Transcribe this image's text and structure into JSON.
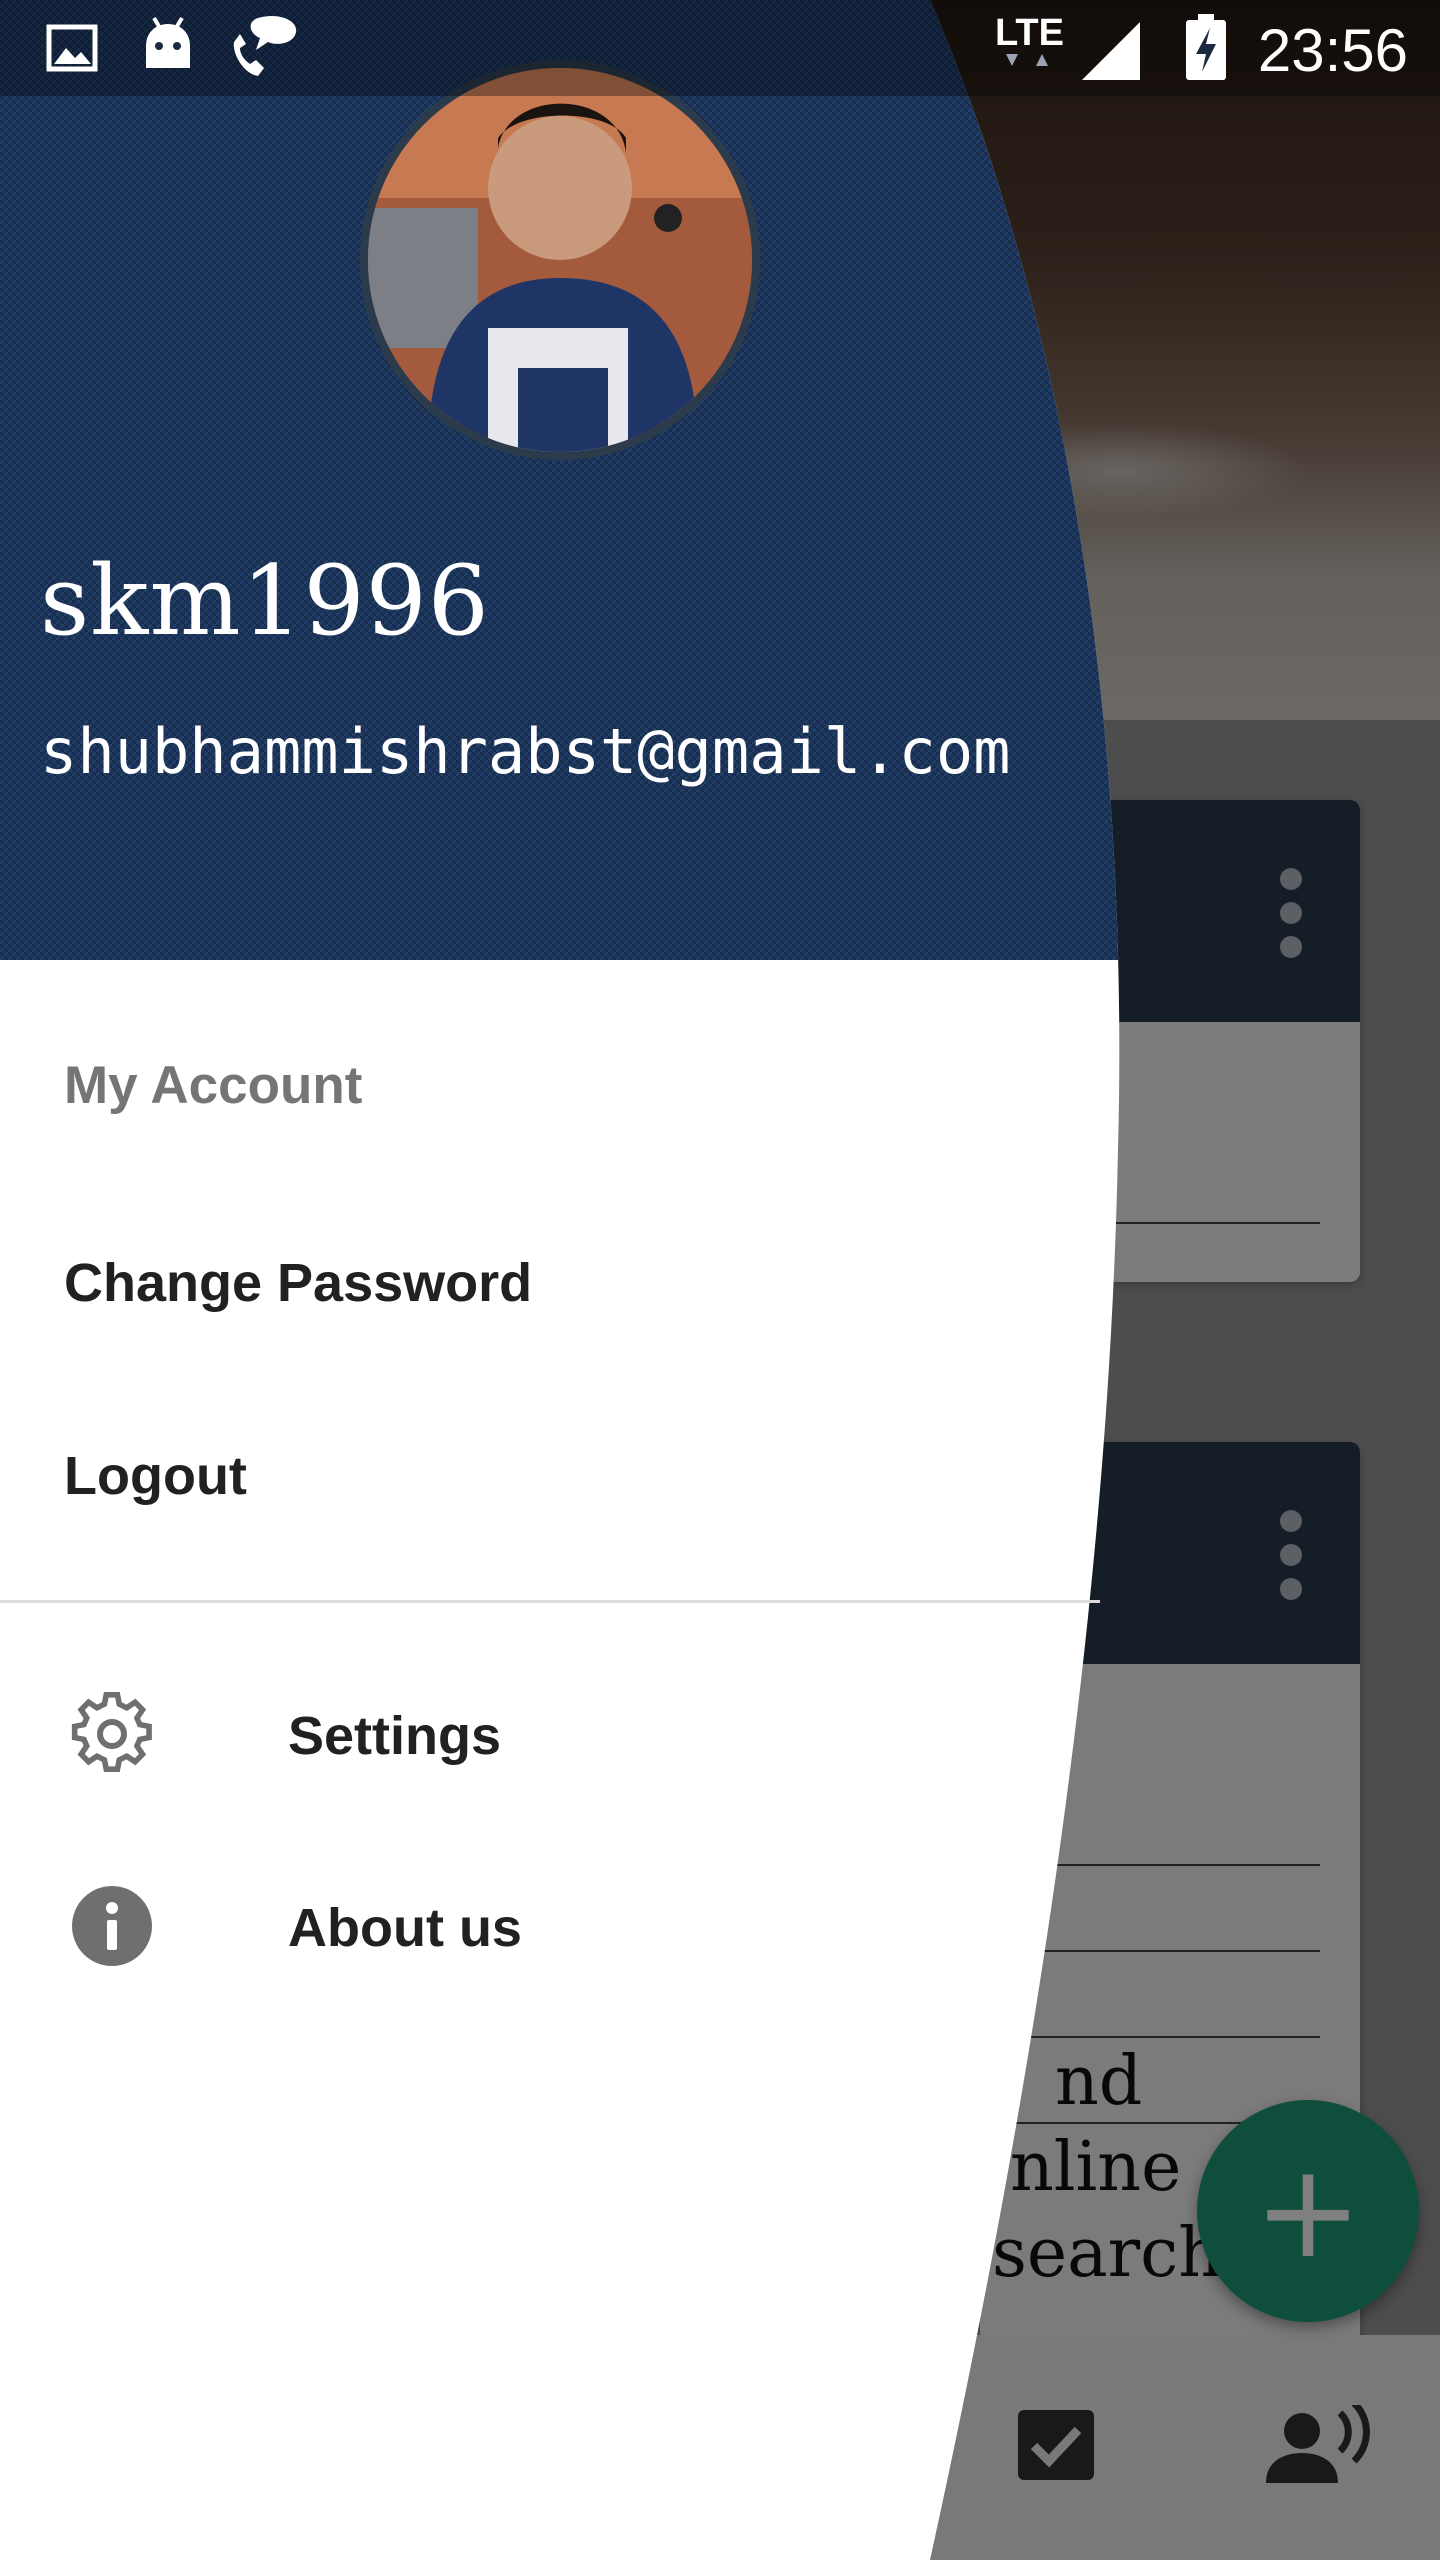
{
  "status_bar": {
    "time": "23:56",
    "network": "LTE",
    "icons": [
      "gallery-icon",
      "android-icon",
      "phone-chat-icon",
      "signal-icon",
      "battery-charging-icon"
    ]
  },
  "drawer": {
    "username": "skm1996",
    "email": "shubhammishrabst@gmail.com",
    "section_label": "My Account",
    "items": [
      {
        "label": "Change Password"
      },
      {
        "label": "Logout"
      }
    ],
    "footer_items": [
      {
        "label": "Settings",
        "icon": "gear-icon"
      },
      {
        "label": "About us",
        "icon": "info-icon"
      }
    ]
  },
  "background_app": {
    "visible_text_fragments": [
      "nd",
      "nline",
      "search"
    ],
    "fab_label": "+",
    "bottom_icons": [
      "checkbox-icon",
      "voice-user-icon"
    ]
  },
  "colors": {
    "header_blue": "#1b3358",
    "fab_green": "#1f9a78",
    "drawer_white": "#ffffff",
    "menu_text": "#212121",
    "section_label": "#757575"
  }
}
